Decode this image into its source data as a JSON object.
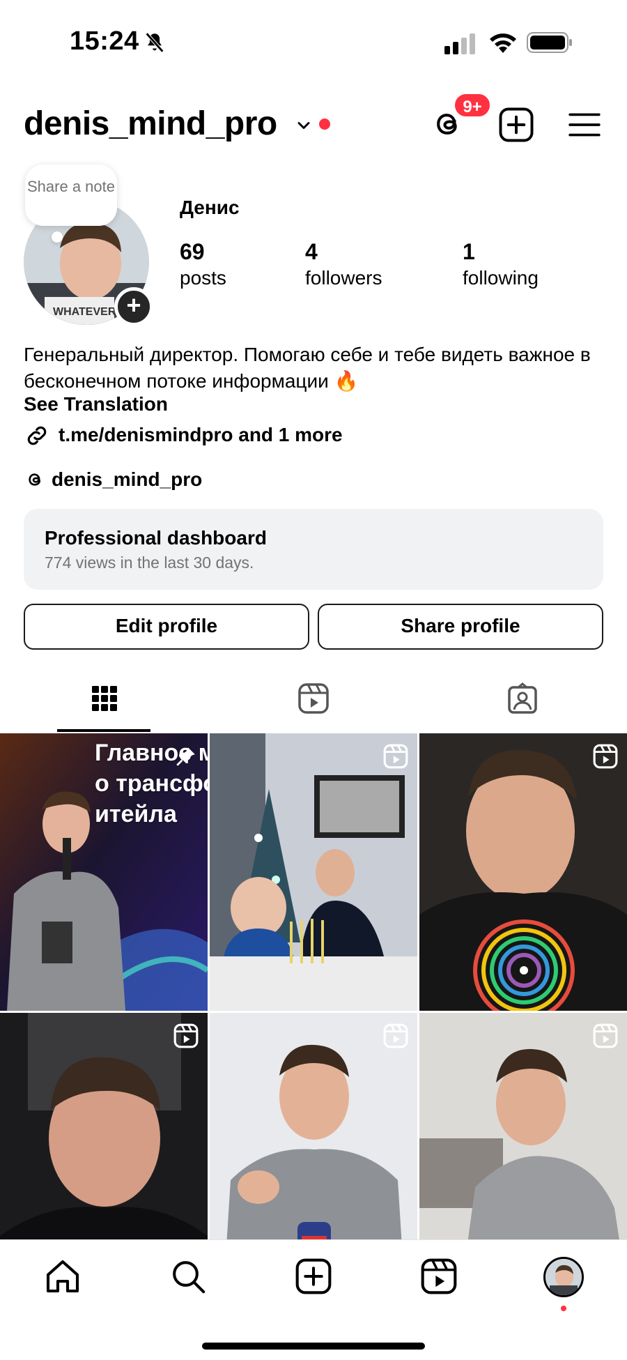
{
  "status_bar": {
    "time": "15:24"
  },
  "header": {
    "username": "denis_mind_pro",
    "notification_badge": "9+"
  },
  "profile": {
    "note_bubble": "Share a note",
    "full_name": "Денис",
    "stats": [
      {
        "value": "69",
        "label": "posts"
      },
      {
        "value": "4",
        "label": "followers"
      },
      {
        "value": "1",
        "label": "following"
      }
    ],
    "bio": "Генеральный директор. Помогаю себе и тебе видеть важное в бесконечном потоке информации 🔥",
    "see_translation": "See Translation",
    "link_text": "t.me/denismindpro and 1 more",
    "threads_handle": "denis_mind_pro"
  },
  "dashboard": {
    "title": "Professional dashboard",
    "subtitle": "774 views in the last 30 days."
  },
  "buttons": {
    "edit": "Edit profile",
    "share": "Share profile"
  },
  "tabs": [
    {
      "icon": "grid-icon",
      "active": true
    },
    {
      "icon": "reels-icon",
      "active": false
    },
    {
      "icon": "tagged-icon",
      "active": false
    }
  ],
  "posts": [
    {
      "type": "photo",
      "pinned": true,
      "overlay_text": "Главное м\nо трансфо\nитейла"
    },
    {
      "type": "reel",
      "pinned": false
    },
    {
      "type": "reel",
      "pinned": false
    },
    {
      "type": "reel",
      "pinned": false
    },
    {
      "type": "reel",
      "pinned": false
    },
    {
      "type": "reel",
      "pinned": false
    }
  ],
  "bottom_nav": [
    "home-icon",
    "search-icon",
    "create-icon",
    "reels-icon",
    "profile-avatar"
  ],
  "colors": {
    "accent_red": "#ff3040",
    "dashboard_bg": "#f1f2f4",
    "muted_text": "#737373"
  }
}
